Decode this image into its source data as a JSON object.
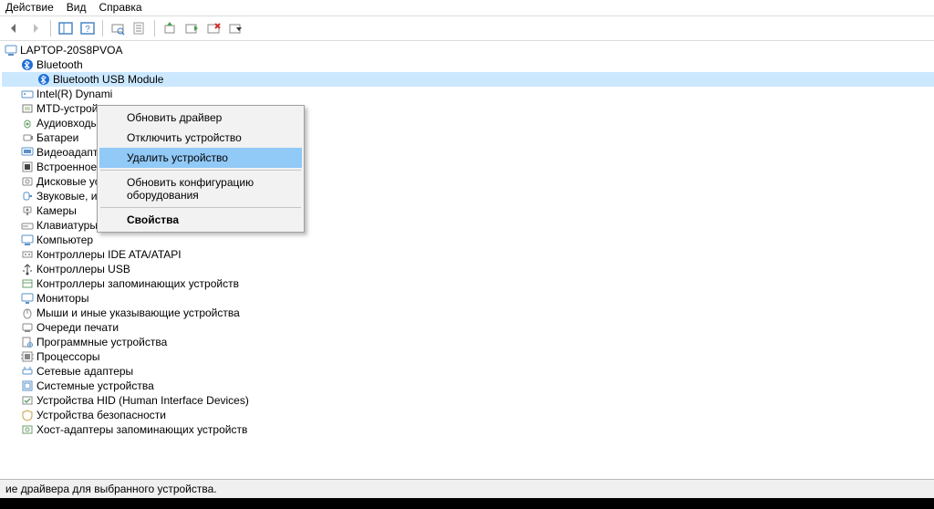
{
  "menubar": {
    "action": "Действие",
    "view": "Вид",
    "help": "Справка"
  },
  "toolbar_icons": [
    "back",
    "forward",
    "show-hide",
    "help",
    "scan",
    "properties",
    "enable",
    "disable",
    "uninstall"
  ],
  "root": "LAPTOP-20S8PVOA",
  "bluetooth": {
    "category": "Bluetooth",
    "device": "Bluetooth USB Module"
  },
  "categories": [
    "Intel(R) Dynami",
    "MTD-устройст",
    "Аудиовходы и а",
    "Батареи",
    "Видеоадаптеры",
    "Встроенное ПО",
    "Дисковые устр",
    "Звуковые, игровые и видеоустройства",
    "Камеры",
    "Клавиатуры",
    "Компьютер",
    "Контроллеры IDE ATA/ATAPI",
    "Контроллеры USB",
    "Контроллеры запоминающих устройств",
    "Мониторы",
    "Мыши и иные указывающие устройства",
    "Очереди печати",
    "Программные устройства",
    "Процессоры",
    "Сетевые адаптеры",
    "Системные устройства",
    "Устройства HID (Human Interface Devices)",
    "Устройства безопасности",
    "Хост-адаптеры запоминающих устройств"
  ],
  "contextmenu": {
    "update_driver": "Обновить драйвер",
    "disable": "Отключить устройство",
    "uninstall": "Удалить устройство",
    "scan": "Обновить конфигурацию оборудования",
    "properties": "Свойства"
  },
  "status": "ие драйвера для выбранного устройства."
}
